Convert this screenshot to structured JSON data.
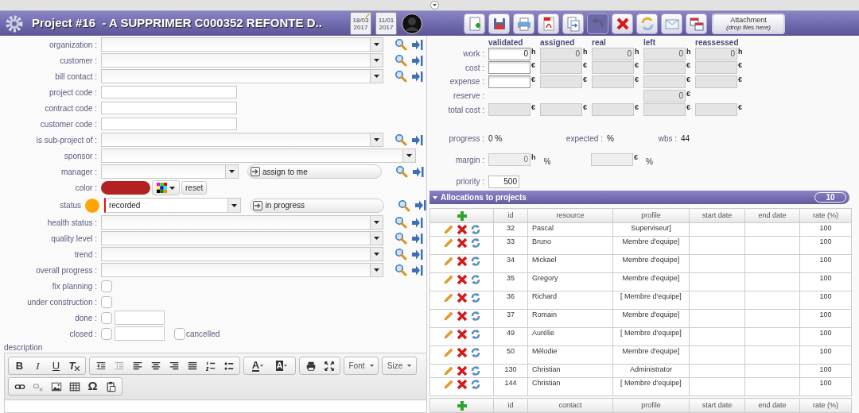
{
  "header": {
    "title": "Project #16  - A SUPPRIMER C000352 REFONTE D..",
    "dates": [
      {
        "kind": "edited",
        "day": "18/03",
        "year": "2017"
      },
      {
        "kind": "plain",
        "day": "11/01",
        "year": "2017"
      }
    ]
  },
  "toolbar": [
    {
      "kind": "new",
      "disabled": false
    },
    {
      "kind": "save",
      "disabled": false
    },
    {
      "kind": "print",
      "disabled": false
    },
    {
      "kind": "pdf",
      "disabled": false
    },
    {
      "kind": "copy",
      "disabled": false
    },
    {
      "kind": "undo",
      "disabled": true
    },
    {
      "kind": "delete",
      "disabled": false
    },
    {
      "kind": "refresh",
      "disabled": false
    },
    {
      "kind": "email",
      "disabled": false
    },
    {
      "kind": "multi",
      "disabled": false
    }
  ],
  "attachment": {
    "label": "Attachment",
    "hint": "(drop files here)"
  },
  "form": [
    {
      "kind": "select",
      "label": "organization :"
    },
    {
      "kind": "select",
      "label": "customer :"
    },
    {
      "kind": "select",
      "label": "bill contact :"
    },
    {
      "kind": "text",
      "label": "project code :"
    },
    {
      "kind": "text",
      "label": "contract code :"
    },
    {
      "kind": "text",
      "label": "customer code :"
    },
    {
      "kind": "select",
      "label": "is sub-project of :"
    },
    {
      "kind": "wide",
      "label": "sponsor :"
    },
    {
      "kind": "manager",
      "label": "manager :",
      "button": "assign to me"
    },
    {
      "kind": "color",
      "label": "color :",
      "color": "#b22222",
      "button": "reset"
    },
    {
      "kind": "status",
      "label": "status",
      "value": "recorded",
      "color": "#ffa500",
      "button": "in progress"
    },
    {
      "kind": "select",
      "label": "health status :"
    },
    {
      "kind": "select",
      "label": "quality level :"
    },
    {
      "kind": "select",
      "label": "trend :"
    },
    {
      "kind": "select",
      "label": "overall progress :"
    },
    {
      "kind": "checkbox",
      "label": "fix planning :",
      "checked": false
    },
    {
      "kind": "checkbox",
      "label": "under construction :",
      "checked": false
    },
    {
      "kind": "checkdate",
      "label": "done :",
      "checked": false
    },
    {
      "kind": "checkdate",
      "label": "closed :",
      "checked": false,
      "extra": {
        "label": "cancelled",
        "checked": false
      }
    }
  ],
  "description": {
    "label": "description",
    "toolbar": [
      [
        [
          {
            "kind": "bold",
            "label": "B"
          },
          {
            "kind": "italic",
            "label": "I"
          },
          {
            "kind": "underline",
            "label": "U"
          },
          {
            "kind": "clear-format",
            "label": "T"
          }
        ],
        [
          {
            "kind": "outdent"
          },
          {
            "kind": "indent",
            "disabled": true
          },
          {
            "kind": "align-left"
          },
          {
            "kind": "align-center"
          },
          {
            "kind": "align-right"
          },
          {
            "kind": "justify"
          },
          {
            "kind": "numbered-list"
          },
          {
            "kind": "bullet-list"
          }
        ],
        [
          {
            "kind": "text-color",
            "label": "A"
          },
          {
            "kind": "background-color",
            "label": "A"
          }
        ],
        [
          {
            "kind": "print"
          },
          {
            "kind": "maximize"
          }
        ],
        [
          {
            "kind": "menu",
            "label": "Font"
          }
        ],
        [
          {
            "kind": "menu",
            "label": "Size"
          }
        ]
      ],
      [
        [
          {
            "kind": "link"
          },
          {
            "kind": "unlink",
            "disabled": true
          },
          {
            "kind": "image"
          },
          {
            "kind": "table"
          },
          {
            "kind": "symbol",
            "label": "Ω"
          },
          {
            "kind": "paste"
          }
        ]
      ]
    ]
  },
  "costs": {
    "columns": [
      "validated",
      "assigned",
      "real",
      "left",
      "reassessed"
    ],
    "rows": [
      {
        "label": "work :",
        "cells": [
          {
            "value": "0",
            "unit": "h",
            "editable": true
          },
          {
            "value": "0",
            "unit": "h",
            "editable": false
          },
          {
            "value": "0",
            "unit": "h",
            "editable": false
          },
          {
            "value": "0",
            "unit": "h",
            "editable": false
          },
          {
            "value": "0",
            "unit": "h",
            "editable": false
          }
        ]
      },
      {
        "label": "cost :",
        "cells": [
          {
            "unit": "€",
            "editable": true
          },
          {
            "unit": "€",
            "editable": false
          },
          {
            "unit": "€",
            "editable": false
          },
          {
            "unit": "€",
            "editable": false
          },
          {
            "unit": "€",
            "editable": false
          }
        ]
      },
      {
        "label": "expense :",
        "cells": [
          {
            "unit": "€",
            "editable": true
          },
          {
            "unit": "€",
            "editable": false
          },
          {
            "unit": "€",
            "editable": false
          },
          {
            "unit": "€",
            "editable": false
          },
          {
            "unit": "€",
            "editable": false
          }
        ]
      },
      {
        "label": "reserve :",
        "cells": [
          null,
          null,
          null,
          {
            "value": "0",
            "unit": "€",
            "editable": false
          },
          null
        ]
      },
      {
        "label": "total cost :",
        "cells": [
          {
            "unit": "€",
            "editable": false
          },
          {
            "unit": "€",
            "editable": false
          },
          {
            "unit": "€",
            "editable": false
          },
          {
            "unit": "€",
            "editable": false
          },
          {
            "unit": "€",
            "editable": false
          }
        ]
      }
    ]
  },
  "summary": [
    {
      "label": "progress :",
      "value": "0 %"
    },
    {
      "label": "expected :",
      "value": "%"
    },
    {
      "label": "wbs :",
      "value": "44"
    }
  ],
  "margin": {
    "label": "margin :",
    "parts": [
      {
        "value": "0",
        "unit": "h",
        "percent": "%"
      },
      {
        "unit": "€",
        "percent": "%"
      }
    ]
  },
  "priority": {
    "label": "priority :",
    "value": "500"
  },
  "allocations": {
    "title": "Allocations to projects",
    "count": "10",
    "columns": [
      "id",
      "resource",
      "profile",
      "start date",
      "end date",
      "rate (%)"
    ],
    "rows": [
      {
        "id": "32",
        "resource": "Pascal",
        "profile": "Superviseur]",
        "rate": "100"
      },
      {
        "id": "33",
        "resource": "Bruno",
        "profile": "Membre d'equipe]",
        "rate": "100"
      },
      {
        "id": "34",
        "resource": "Mickael",
        "profile": "Membre d'equipe]",
        "rate": "100"
      },
      {
        "id": "35",
        "resource": "Gregory",
        "profile": "Membre d'equipe]",
        "rate": "100"
      },
      {
        "id": "36",
        "resource": "Richard",
        "profile": "[ Membre d'equipe]",
        "rate": "100"
      },
      {
        "id": "37",
        "resource": "Romain",
        "profile": "Membre d'equipe]",
        "rate": "100"
      },
      {
        "id": "49",
        "resource": "Aurélie",
        "profile": "[ Membre d'equipe]",
        "rate": "100"
      },
      {
        "id": "50",
        "resource": "Mélodie",
        "profile": "Membre d'equipe]",
        "rate": "100"
      },
      {
        "id": "130",
        "resource": "Christian",
        "profile": "Administrator",
        "rate": "100"
      },
      {
        "id": "144",
        "resource": "Christian",
        "profile": "[ Membre d'equipe]",
        "rate": "100"
      }
    ]
  },
  "contacts": {
    "columns": [
      "id",
      "contact",
      "profile",
      "start date",
      "end date",
      "rate (%)"
    ]
  }
}
